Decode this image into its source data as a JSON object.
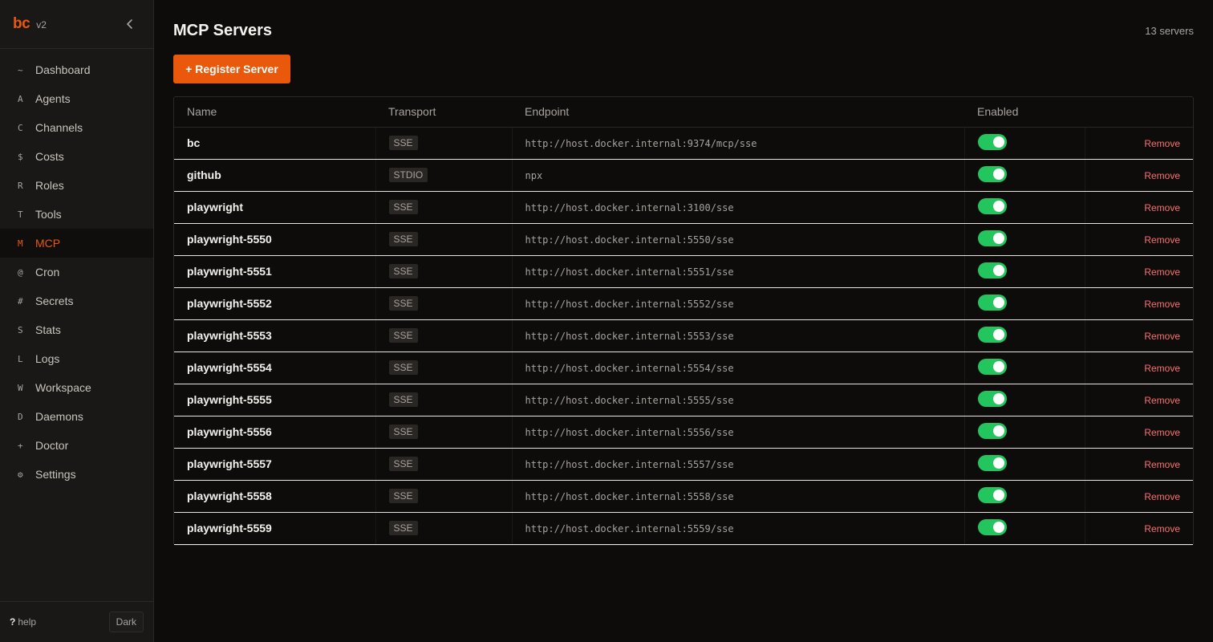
{
  "brand": {
    "logo": "bc",
    "version": "v2"
  },
  "sidebar": {
    "items": [
      {
        "glyph": "~",
        "label": "Dashboard"
      },
      {
        "glyph": "A",
        "label": "Agents"
      },
      {
        "glyph": "C",
        "label": "Channels"
      },
      {
        "glyph": "$",
        "label": "Costs"
      },
      {
        "glyph": "R",
        "label": "Roles"
      },
      {
        "glyph": "T",
        "label": "Tools"
      },
      {
        "glyph": "M",
        "label": "MCP",
        "active": true
      },
      {
        "glyph": "@",
        "label": "Cron"
      },
      {
        "glyph": "#",
        "label": "Secrets"
      },
      {
        "glyph": "S",
        "label": "Stats"
      },
      {
        "glyph": "L",
        "label": "Logs"
      },
      {
        "glyph": "W",
        "label": "Workspace"
      },
      {
        "glyph": "D",
        "label": "Daemons"
      },
      {
        "glyph": "+",
        "label": "Doctor"
      },
      {
        "glyph": "⚙",
        "label": "Settings"
      }
    ],
    "footer": {
      "help_q": "?",
      "help_label": "help",
      "theme_label": "Dark"
    }
  },
  "main": {
    "title": "MCP Servers",
    "count": "13 servers",
    "register_label": "+ Register Server",
    "table": {
      "headers": {
        "name": "Name",
        "transport": "Transport",
        "endpoint": "Endpoint",
        "enabled": "Enabled"
      },
      "remove_label": "Remove",
      "rows": [
        {
          "name": "bc",
          "transport": "SSE",
          "endpoint": "http://host.docker.internal:9374/mcp/sse",
          "enabled": true
        },
        {
          "name": "github",
          "transport": "STDIO",
          "endpoint": "npx",
          "enabled": true
        },
        {
          "name": "playwright",
          "transport": "SSE",
          "endpoint": "http://host.docker.internal:3100/sse",
          "enabled": true
        },
        {
          "name": "playwright-5550",
          "transport": "SSE",
          "endpoint": "http://host.docker.internal:5550/sse",
          "enabled": true
        },
        {
          "name": "playwright-5551",
          "transport": "SSE",
          "endpoint": "http://host.docker.internal:5551/sse",
          "enabled": true
        },
        {
          "name": "playwright-5552",
          "transport": "SSE",
          "endpoint": "http://host.docker.internal:5552/sse",
          "enabled": true
        },
        {
          "name": "playwright-5553",
          "transport": "SSE",
          "endpoint": "http://host.docker.internal:5553/sse",
          "enabled": true
        },
        {
          "name": "playwright-5554",
          "transport": "SSE",
          "endpoint": "http://host.docker.internal:5554/sse",
          "enabled": true
        },
        {
          "name": "playwright-5555",
          "transport": "SSE",
          "endpoint": "http://host.docker.internal:5555/sse",
          "enabled": true
        },
        {
          "name": "playwright-5556",
          "transport": "SSE",
          "endpoint": "http://host.docker.internal:5556/sse",
          "enabled": true
        },
        {
          "name": "playwright-5557",
          "transport": "SSE",
          "endpoint": "http://host.docker.internal:5557/sse",
          "enabled": true
        },
        {
          "name": "playwright-5558",
          "transport": "SSE",
          "endpoint": "http://host.docker.internal:5558/sse",
          "enabled": true
        },
        {
          "name": "playwright-5559",
          "transport": "SSE",
          "endpoint": "http://host.docker.internal:5559/sse",
          "enabled": true
        }
      ]
    }
  },
  "colors": {
    "accent": "#ea580c",
    "toggle_on": "#22c55e",
    "remove": "#f87171"
  }
}
